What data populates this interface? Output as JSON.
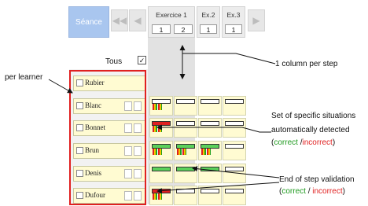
{
  "nav": {
    "seance_label": "Séance",
    "columns": [
      {
        "title": "Exercice 1",
        "steps": [
          "1",
          "2"
        ]
      },
      {
        "title": "Ex.2",
        "steps": [
          "1"
        ]
      },
      {
        "title": "Ex.3",
        "steps": [
          "1"
        ]
      }
    ]
  },
  "panel": {
    "tous_label": "Tous",
    "tous_checked": "✓",
    "learners": [
      "Rubier",
      "Blanc",
      "Bonnet",
      "Brun",
      "Denis",
      "Dufour"
    ]
  },
  "annotations": {
    "per_learner": "per learner",
    "column_per_step": "1 column per step",
    "situations_line1": "Set of specific situations",
    "situations_line2": "automatically detected",
    "correct": "correct",
    "incorrect": "incorrect",
    "end_step": "End of step validation",
    "slash": "/",
    "open_paren": "(",
    "close_paren": ")"
  },
  "colors": {
    "correct": "#1f9a1f",
    "incorrect": "#e02020",
    "seance": "#a9c6ef"
  }
}
